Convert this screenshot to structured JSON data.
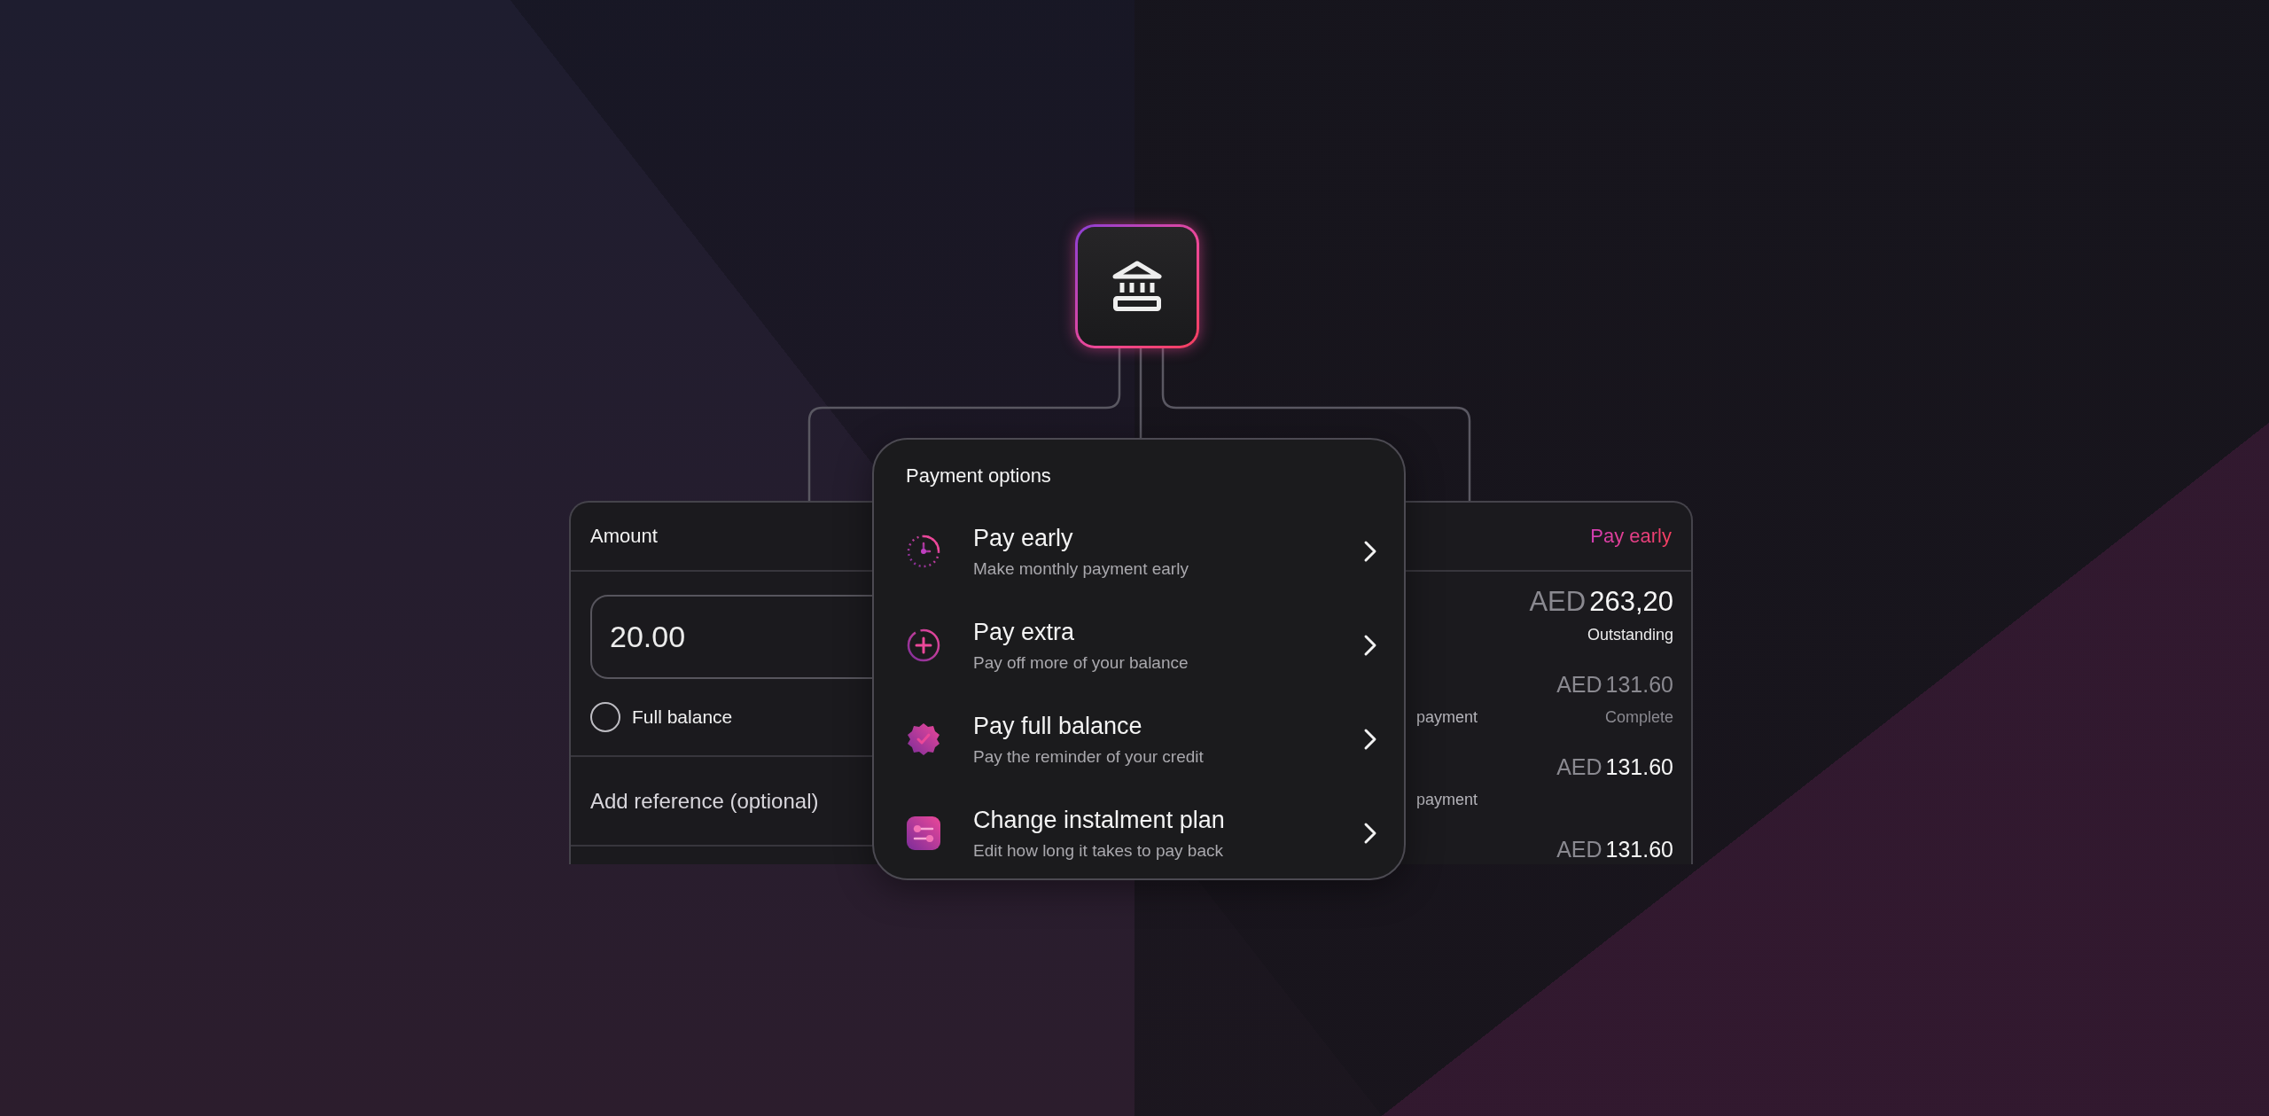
{
  "amount_card": {
    "title": "Amount",
    "amount_value": "20.00",
    "full_balance": {
      "label": "Full balance",
      "checked": false
    },
    "reference": {
      "placeholder": "Add reference (optional)"
    }
  },
  "payment_options": {
    "title": "Payment options",
    "items": [
      {
        "kind": "clock",
        "title": "Pay early",
        "subtitle": "Make monthly payment early"
      },
      {
        "kind": "plus",
        "title": "Pay extra",
        "subtitle": "Pay off more of your balance"
      },
      {
        "kind": "badge",
        "title": "Pay full balance",
        "subtitle": "Pay the reminder of your credit"
      },
      {
        "kind": "sliders",
        "title": "Change instalment plan",
        "subtitle": "Edit how long it takes to pay back"
      }
    ]
  },
  "schedule_card": {
    "link": "Pay early",
    "rows": [
      {
        "kind": "total",
        "currency": "AED",
        "amount": "263,20",
        "caption": "Outstanding",
        "complete": false
      },
      {
        "kind": "instalment",
        "currency": "AED",
        "amount": "131.60",
        "caption": "Complete",
        "label": "payment",
        "complete": true
      },
      {
        "kind": "instalment",
        "currency": "AED",
        "amount": "131.60",
        "label": "payment",
        "complete": false
      },
      {
        "kind": "instalment",
        "currency": "AED",
        "amount": "131.60",
        "complete": false
      }
    ]
  }
}
